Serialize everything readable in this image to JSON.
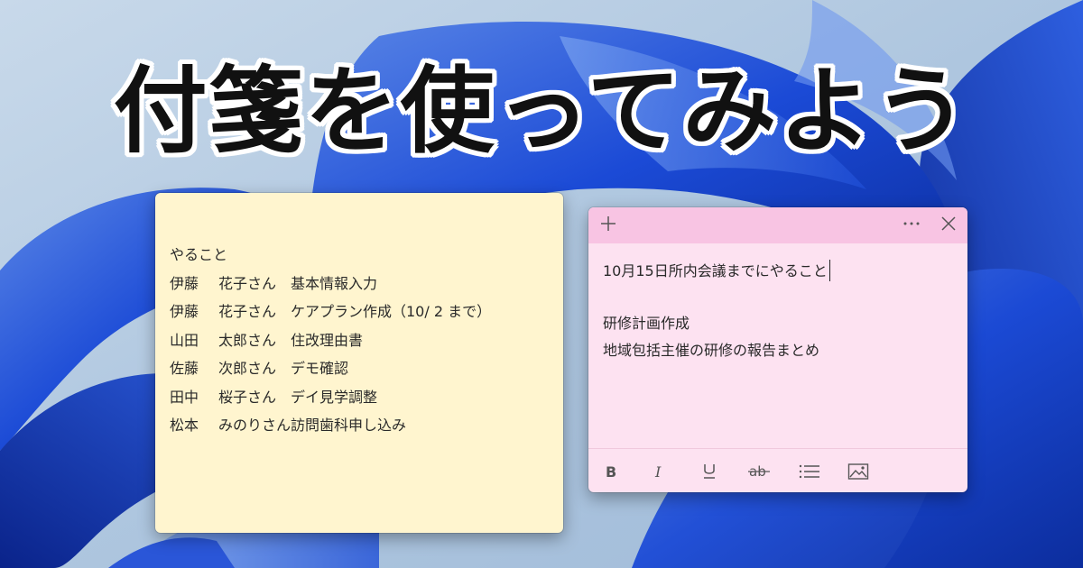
{
  "headline": "付箋を使ってみよう",
  "colors": {
    "wallpaper_base": "#b9cfe3",
    "wallpaper_bloom": "#1743c9",
    "yellow_note": "#fff5cf",
    "pink_note": "#fde2f1",
    "pink_header": "#f8c4e3"
  },
  "yellow_note": {
    "rows": [
      {
        "c1": "やること",
        "c2": "",
        "c3": ""
      },
      {
        "c1": "伊藤",
        "c2": "花子さん",
        "c3": "基本情報入力"
      },
      {
        "c1": "伊藤",
        "c2": "花子さん",
        "c3": "ケアプラン作成（10/ 2 まで）"
      },
      {
        "c1": "山田",
        "c2": "太郎さん",
        "c3": "住改理由書"
      },
      {
        "c1": "佐藤",
        "c2": "次郎さん",
        "c3": "デモ確認"
      },
      {
        "c1": "田中",
        "c2": "桜子さん",
        "c3": "デイ見学調整"
      },
      {
        "c1": "松本",
        "c2": "みのりさん",
        "c3": "訪問歯科申し込み"
      }
    ]
  },
  "pink_note": {
    "header_icons": [
      "plus-icon",
      "more-icon",
      "close-icon"
    ],
    "lines": [
      "10月15日所内会議までにやること",
      "",
      "研修計画作成",
      "地域包括主催の研修の報告まとめ"
    ],
    "toolbar_icons": [
      "bold-icon",
      "italic-icon",
      "underline-icon",
      "strikethrough-icon",
      "bullet-list-icon",
      "image-icon"
    ]
  }
}
